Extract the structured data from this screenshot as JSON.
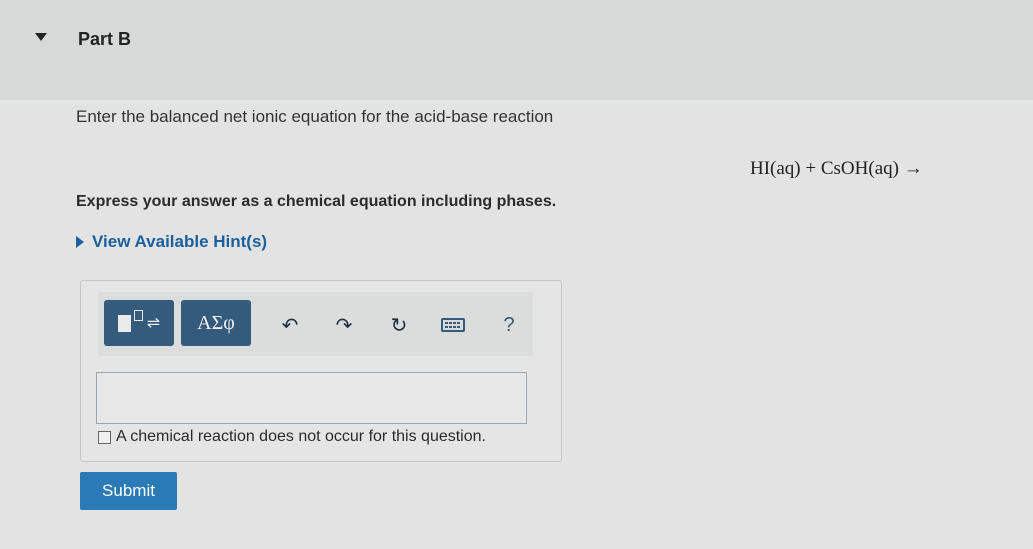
{
  "part": {
    "title": "Part B"
  },
  "question": {
    "prompt": "Enter the balanced net ionic equation for the acid-base reaction",
    "equation": "HI(aq) + CsOH(aq) →",
    "instructions": "Express your answer as a chemical equation including phases.",
    "hints_label": "View Available Hint(s)"
  },
  "toolbar": {
    "symbols_label": "ΑΣφ",
    "help_label": "?",
    "icons": [
      "templates-icon",
      "symbols-icon",
      "undo-icon",
      "redo-icon",
      "reset-icon",
      "keyboard-icon",
      "help-icon"
    ]
  },
  "answer": {
    "value": "",
    "no_reaction_label": "A chemical reaction does not occur for this question."
  },
  "submit": {
    "label": "Submit"
  },
  "colors": {
    "accent": "#2a7ab5",
    "toolbar_button": "#345a7c",
    "link": "#1b5f9c"
  }
}
